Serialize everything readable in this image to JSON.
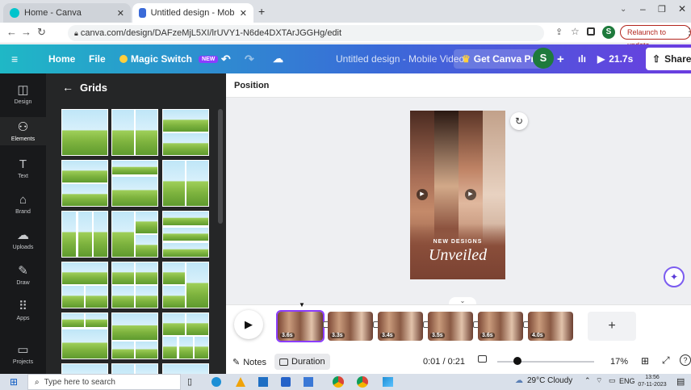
{
  "browser": {
    "tabs": [
      {
        "label": "Home - Canva",
        "active": false
      },
      {
        "label": "Untitled design - Mobile Video",
        "active": true
      }
    ],
    "url": "canva.com/design/DAFzeMjL5XI/lrUVY1-N6de4DXTArJGGHg/edit",
    "relaunch_label": "Relaunch to update",
    "profile_initial": "S"
  },
  "topbar": {
    "home": "Home",
    "file": "File",
    "magic_switch": "Magic Switch",
    "new_badge": "NEW",
    "doc_title": "Untitled design - Mobile Video",
    "get_pro": "Get Canva Pro",
    "avatar_initial": "S",
    "duration": "21.7s",
    "share": "Share"
  },
  "rail": {
    "items": [
      {
        "label": "Design",
        "icon": "design-icon"
      },
      {
        "label": "Elements",
        "icon": "elements-icon"
      },
      {
        "label": "Text",
        "icon": "text-icon"
      },
      {
        "label": "Brand",
        "icon": "brand-icon"
      },
      {
        "label": "Uploads",
        "icon": "upload-icon"
      },
      {
        "label": "Draw",
        "icon": "draw-icon"
      },
      {
        "label": "Apps",
        "icon": "apps-icon"
      },
      {
        "label": "Projects",
        "icon": "folder-icon"
      }
    ],
    "active_index": 1
  },
  "panel": {
    "title": "Grids"
  },
  "editor": {
    "position_label": "Position",
    "design_text_line1": "NEW DESIGNS",
    "design_text_line2": "Unveiled"
  },
  "timeline": {
    "clips": [
      "3.6s",
      "3.3s",
      "3.4s",
      "3.5s",
      "3.6s",
      "4.0s"
    ],
    "add_label": "+"
  },
  "footer": {
    "notes": "Notes",
    "duration": "Duration",
    "time": "0:01 / 0:21",
    "zoom": "17%",
    "zoom_fraction": 0.17
  },
  "taskbar": {
    "search_placeholder": "Type here to search",
    "weather": "29°C Cloudy",
    "lang": "ENG",
    "time": "13:56",
    "date": "07-11-2023"
  },
  "colors": {
    "brand_gradient_start": "#1fb8c6",
    "brand_gradient_end": "#6b3de0",
    "rail_bg": "#18191b",
    "panel_bg": "#252627",
    "selected_clip": "#8b3dff"
  }
}
